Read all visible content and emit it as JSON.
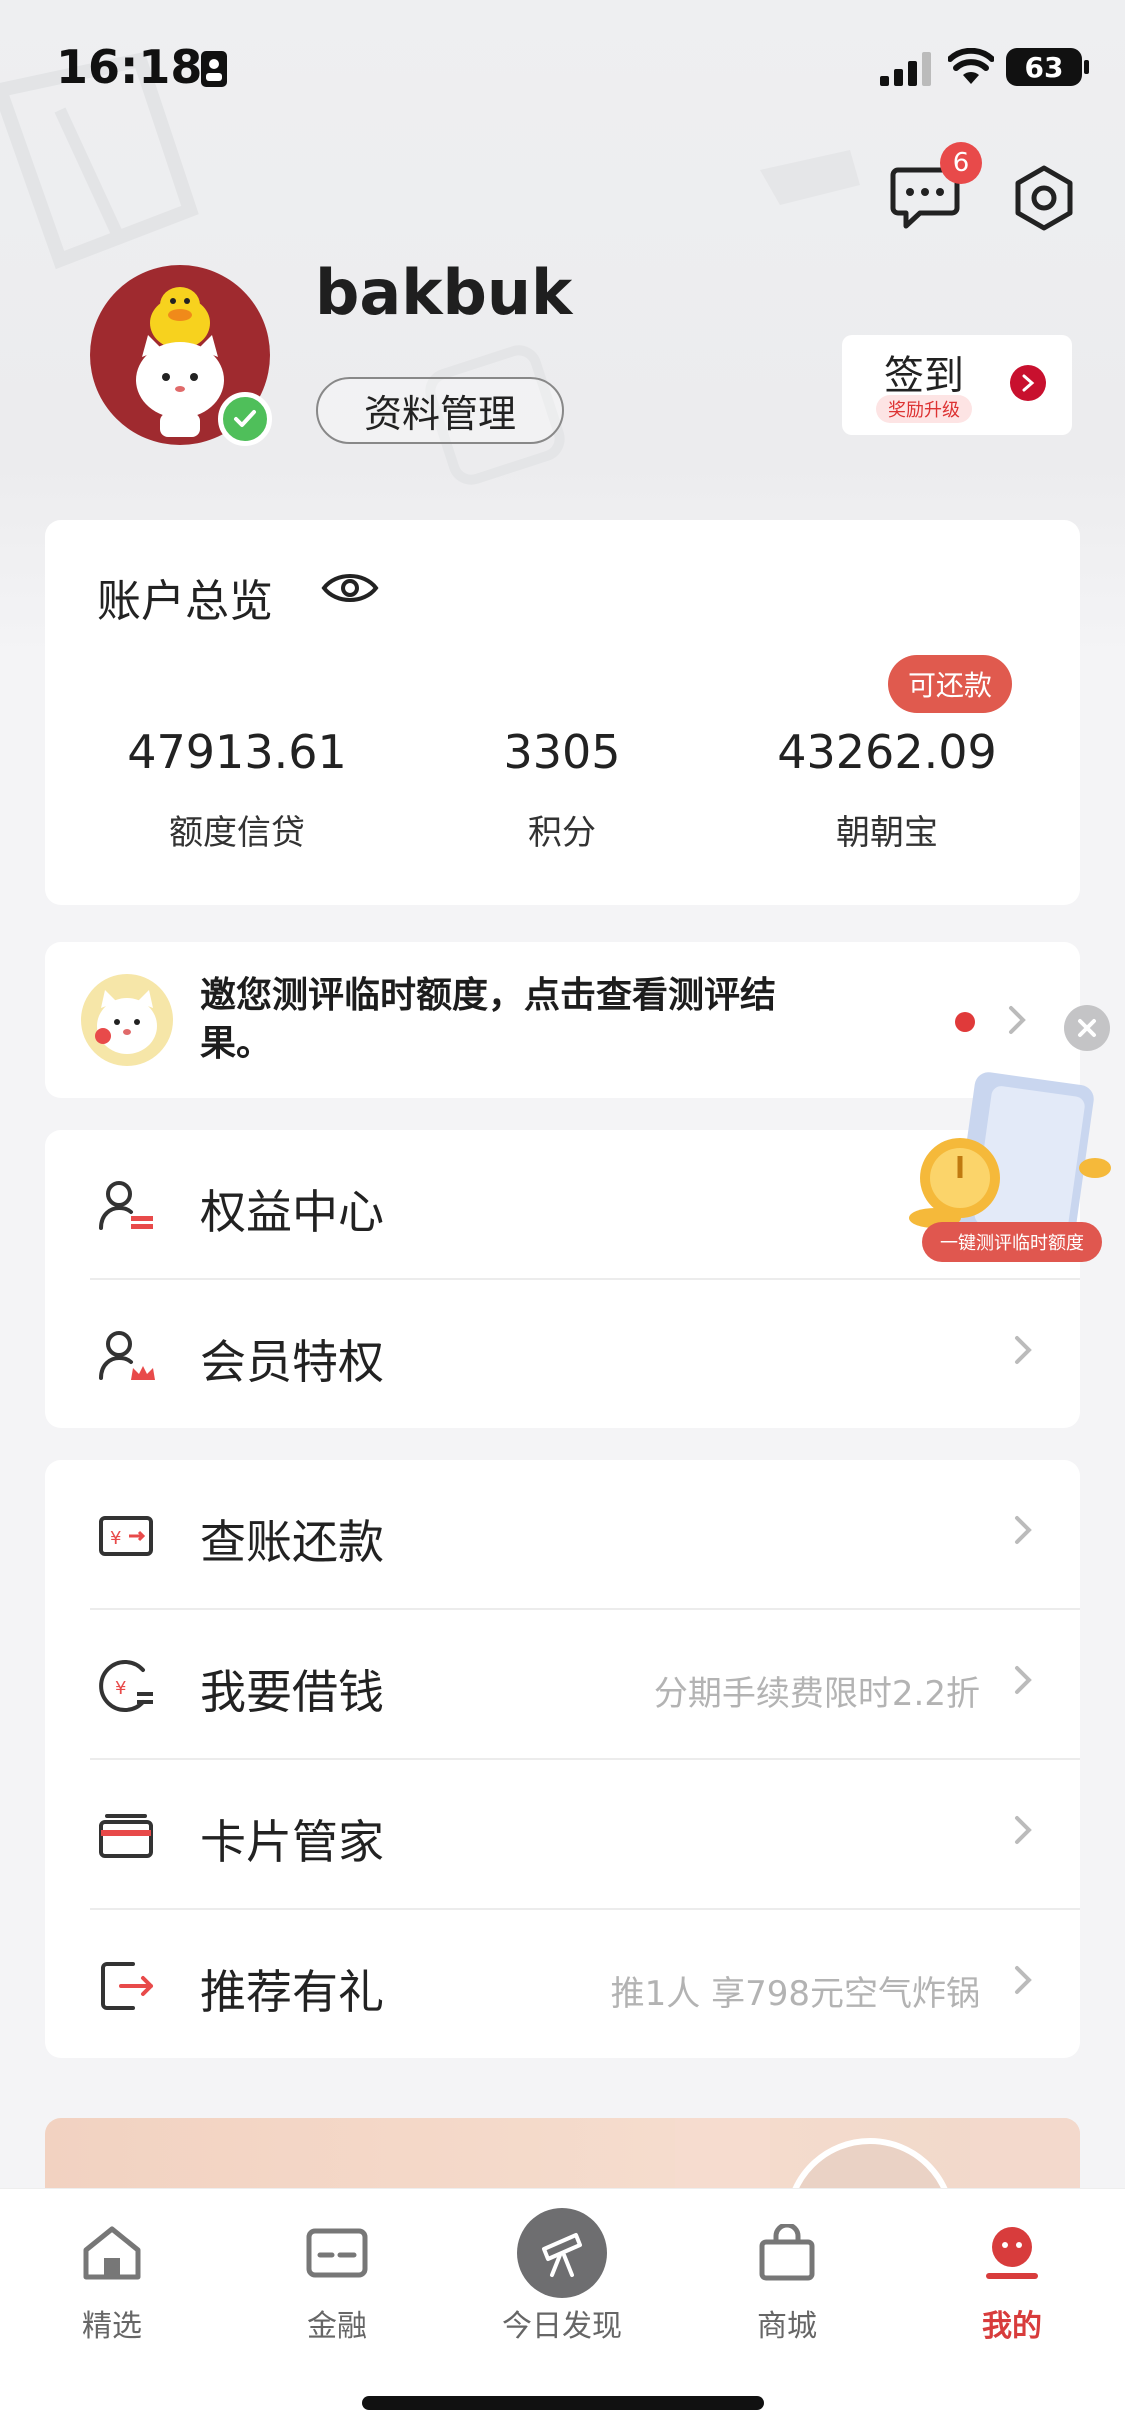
{
  "status_bar": {
    "time": "16:18",
    "battery": "63"
  },
  "header": {
    "message_badge": "6"
  },
  "profile": {
    "username": "bakbuk",
    "manage_label": "资料管理",
    "checkin_label": "签到",
    "checkin_tag": "奖励升级"
  },
  "overview": {
    "title": "账户总览",
    "repay_tag": "可还款",
    "stats": [
      {
        "value": "47913.61",
        "label": "额度信贷"
      },
      {
        "value": "3305",
        "label": "积分"
      },
      {
        "value": "43262.09",
        "label": "朝朝宝"
      }
    ]
  },
  "notice": {
    "text": "邀您测评临时额度，点击查看测评结果。"
  },
  "float_promo": {
    "label": "一键测评临时额度"
  },
  "menu_group_1": [
    {
      "label": "权益中心",
      "icon": "user-card-icon"
    },
    {
      "label": "会员特权",
      "icon": "user-crown-icon"
    }
  ],
  "menu_group_2": [
    {
      "label": "查账还款",
      "hint": "",
      "icon": "bill-icon"
    },
    {
      "label": "我要借钱",
      "hint": "分期手续费限时2.2折",
      "icon": "loan-icon"
    },
    {
      "label": "卡片管家",
      "hint": "",
      "icon": "card-icon"
    },
    {
      "label": "推荐有礼",
      "hint": "推1人 享798元空气炸锅",
      "icon": "share-exit-icon"
    }
  ],
  "tabbar": [
    {
      "label": "精选",
      "icon": "home-icon"
    },
    {
      "label": "金融",
      "icon": "finance-card-icon"
    },
    {
      "label": "今日发现",
      "icon": "telescope-icon"
    },
    {
      "label": "商城",
      "icon": "shopping-bag-icon"
    },
    {
      "label": "我的",
      "icon": "mine-face-icon",
      "active": true
    }
  ],
  "colors": {
    "accent": "#d83c3c",
    "brand_red": "#c8102e",
    "success": "#4fbf5a"
  }
}
